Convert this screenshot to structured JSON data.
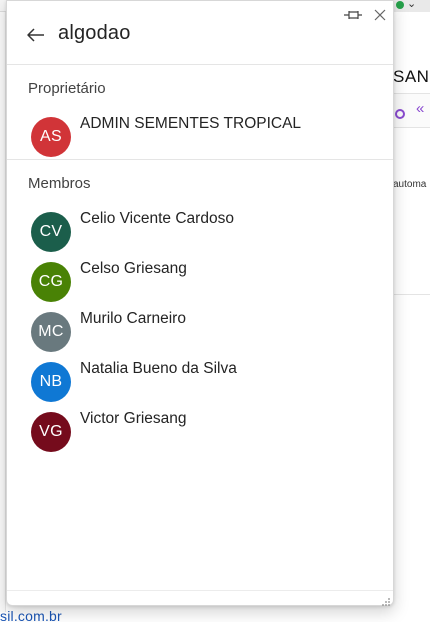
{
  "background": {
    "partial_heading": "SANC",
    "partial_text": "automa",
    "partial_link": "sil.com.br"
  },
  "panel": {
    "title": "algodao",
    "owner_section_label": "Proprietário",
    "members_section_label": "Membros"
  },
  "owner": {
    "initials": "AS",
    "name": "ADMIN SEMENTES TROPICAL",
    "color": "#d13438"
  },
  "members": [
    {
      "initials": "CV",
      "name": "Celio Vicente Cardoso",
      "color": "#1b5e4b"
    },
    {
      "initials": "CG",
      "name": "Celso Griesang",
      "color": "#498205"
    },
    {
      "initials": "MC",
      "name": "Murilo Carneiro",
      "color": "#69797e"
    },
    {
      "initials": "NB",
      "name": "Natalia Bueno da Silva",
      "color": "#0f78d4"
    },
    {
      "initials": "VG",
      "name": "Victor Griesang",
      "color": "#750b1c"
    }
  ],
  "icons": {
    "back": "arrow-left-icon",
    "pin": "pin-icon",
    "close": "close-icon",
    "resize": "resize-grip-icon"
  }
}
